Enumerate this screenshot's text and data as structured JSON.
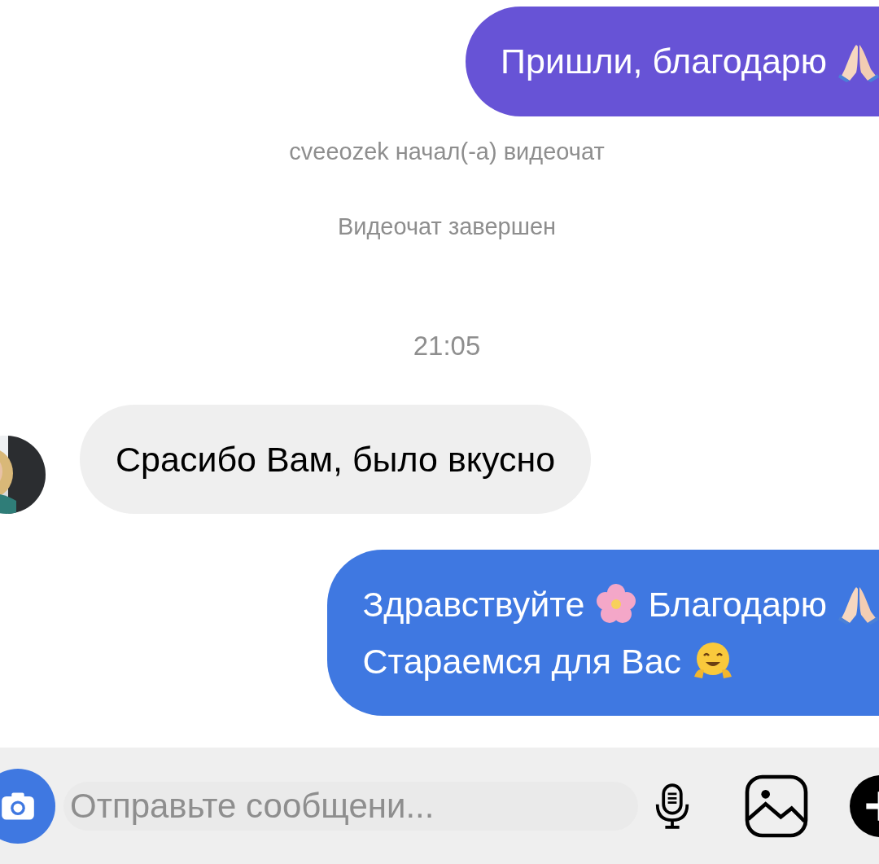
{
  "messages": [
    {
      "kind": "sent",
      "color": "#6753d6",
      "lines": [
        [
          {
            "kind": "text",
            "text": "Пришли, благодарю"
          },
          {
            "kind": "pray"
          }
        ]
      ]
    },
    {
      "kind": "system",
      "text": "cveeozek начал(-а) видеочат"
    },
    {
      "kind": "system",
      "text": "Видеочат завершен"
    },
    {
      "kind": "time",
      "text": "21:05"
    },
    {
      "kind": "received",
      "color": "#efefef",
      "lines": [
        [
          {
            "kind": "text",
            "text": "Срасибо Вам, было вкусно"
          }
        ]
      ]
    },
    {
      "kind": "sent",
      "color": "#3f78e1",
      "lines": [
        [
          {
            "kind": "text",
            "text": "Здравствуйте"
          },
          {
            "kind": "flower"
          },
          {
            "kind": "text",
            "text": "Благодарю"
          },
          {
            "kind": "pray"
          }
        ],
        [
          {
            "kind": "text",
            "text": "Стараемся для Вас"
          },
          {
            "kind": "hug"
          }
        ]
      ]
    }
  ],
  "composer": {
    "placeholder": "Отправьте сообщени..."
  }
}
